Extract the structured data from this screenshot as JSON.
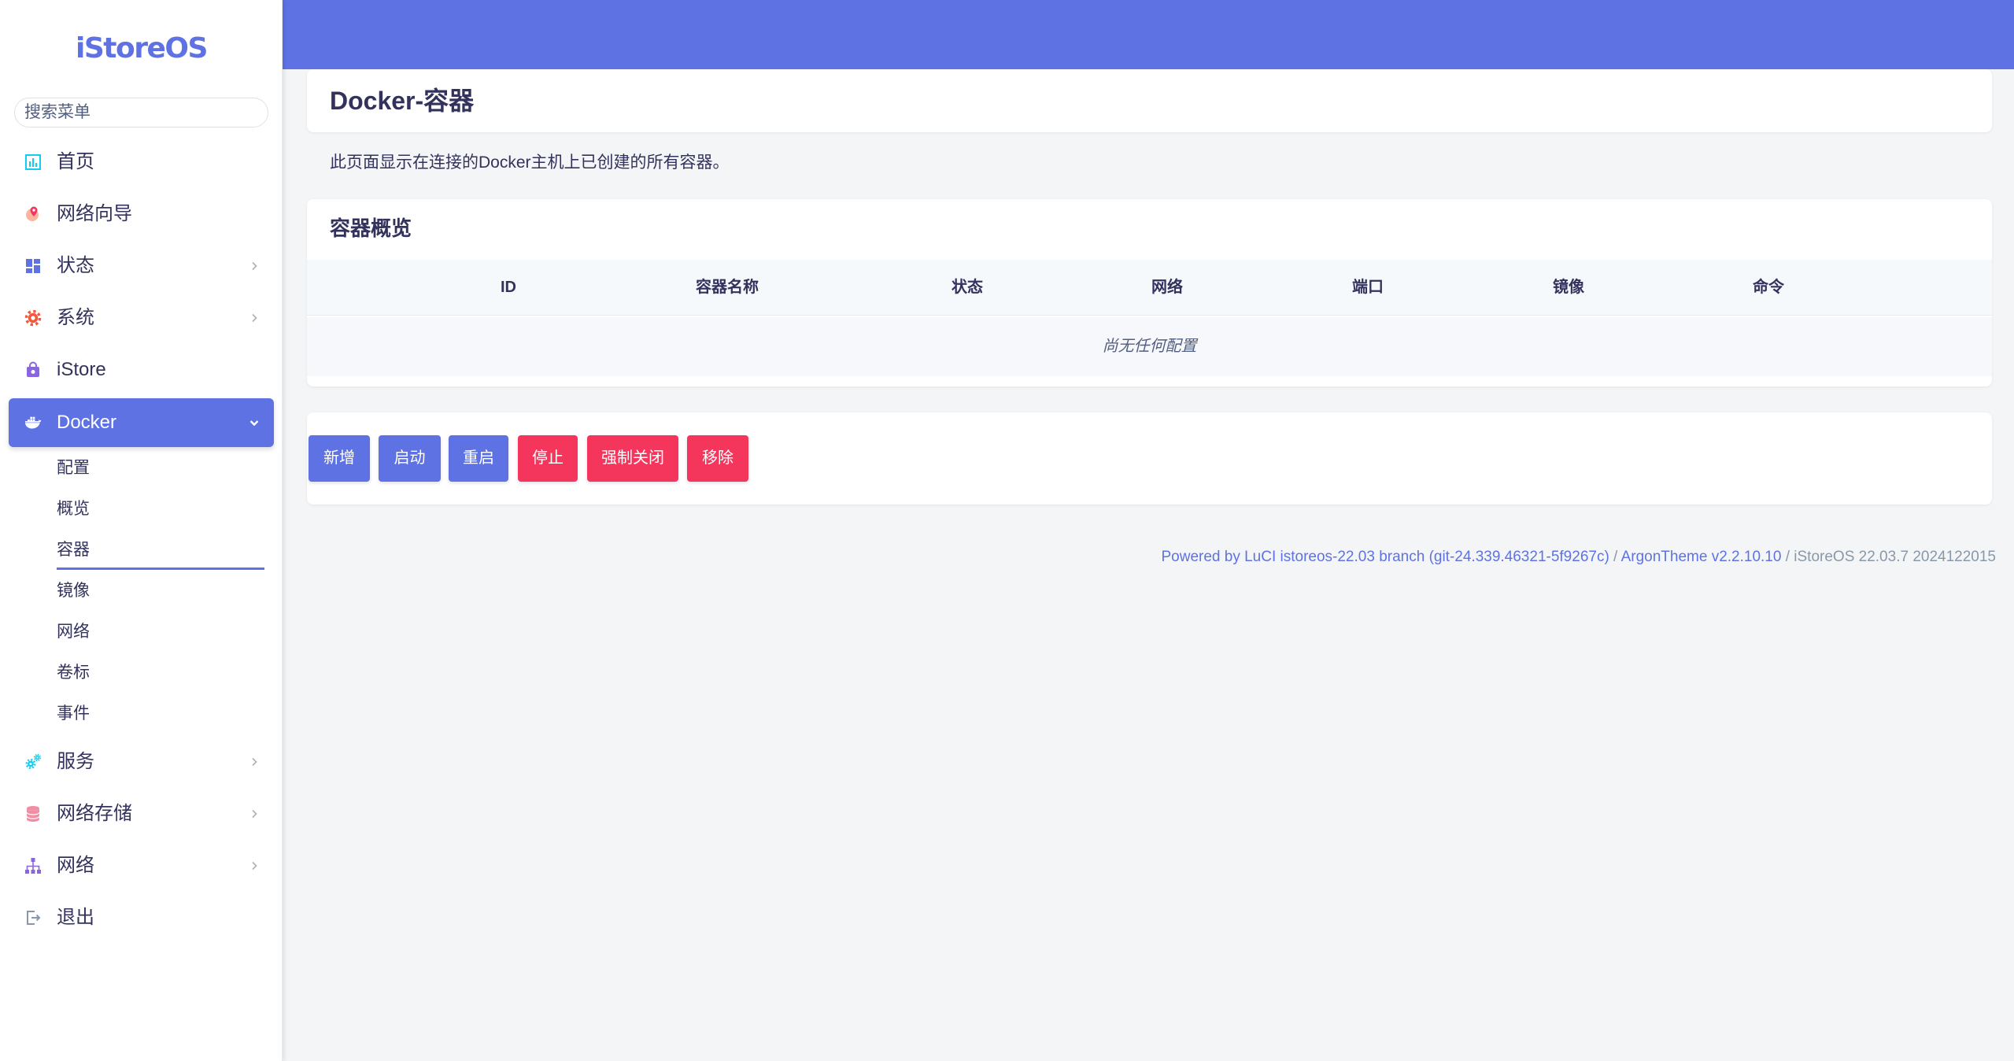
{
  "app": {
    "logo": "iStoreOS",
    "primary_color": "#5e72e4",
    "danger_color": "#f5365c"
  },
  "sidebar": {
    "search": {
      "placeholder": "搜索菜单",
      "value": ""
    },
    "items": [
      {
        "label": "首页",
        "icon": "bar-chart-icon",
        "has_children": false
      },
      {
        "label": "网络向导",
        "icon": "globe-pin-icon",
        "has_children": false
      },
      {
        "label": "状态",
        "icon": "dashboard-icon",
        "has_children": true
      },
      {
        "label": "系统",
        "icon": "gear-icon",
        "has_children": true
      },
      {
        "label": "iStore",
        "icon": "shopping-bag-icon",
        "has_children": false
      },
      {
        "label": "Docker",
        "icon": "docker-icon",
        "has_children": true,
        "active": true,
        "expanded": true,
        "children": [
          {
            "label": "配置"
          },
          {
            "label": "概览"
          },
          {
            "label": "容器",
            "active": true
          },
          {
            "label": "镜像"
          },
          {
            "label": "网络"
          },
          {
            "label": "卷标"
          },
          {
            "label": "事件"
          }
        ]
      },
      {
        "label": "服务",
        "icon": "cogs-icon",
        "has_children": true
      },
      {
        "label": "网络存储",
        "icon": "database-icon",
        "has_children": true
      },
      {
        "label": "网络",
        "icon": "sitemap-icon",
        "has_children": true
      },
      {
        "label": "退出",
        "icon": "sign-out-icon",
        "has_children": false
      }
    ]
  },
  "page": {
    "title": "Docker-容器",
    "description": "此页面显示在连接的Docker主机上已创建的所有容器。",
    "overview": {
      "title": "容器概览",
      "columns": [
        "ID",
        "容器名称",
        "状态",
        "网络",
        "端口",
        "镜像",
        "命令"
      ],
      "rows": [],
      "empty_text": "尚无任何配置"
    },
    "actions": [
      {
        "label": "新增",
        "color": "#5e72e4"
      },
      {
        "label": "启动",
        "color": "#5e72e4"
      },
      {
        "label": "重启",
        "color": "#5e72e4"
      },
      {
        "label": "停止",
        "color": "#f5365c"
      },
      {
        "label": "强制关闭",
        "color": "#f5365c"
      },
      {
        "label": "移除",
        "color": "#f5365c"
      }
    ]
  },
  "footer": {
    "luci": "Powered by LuCI istoreos-22.03 branch (git-24.339.46321-5f9267c)",
    "separator": " / ",
    "theme": "ArgonTheme v2.2.10.10",
    "version": "iStoreOS 22.03.7 2024122015"
  }
}
